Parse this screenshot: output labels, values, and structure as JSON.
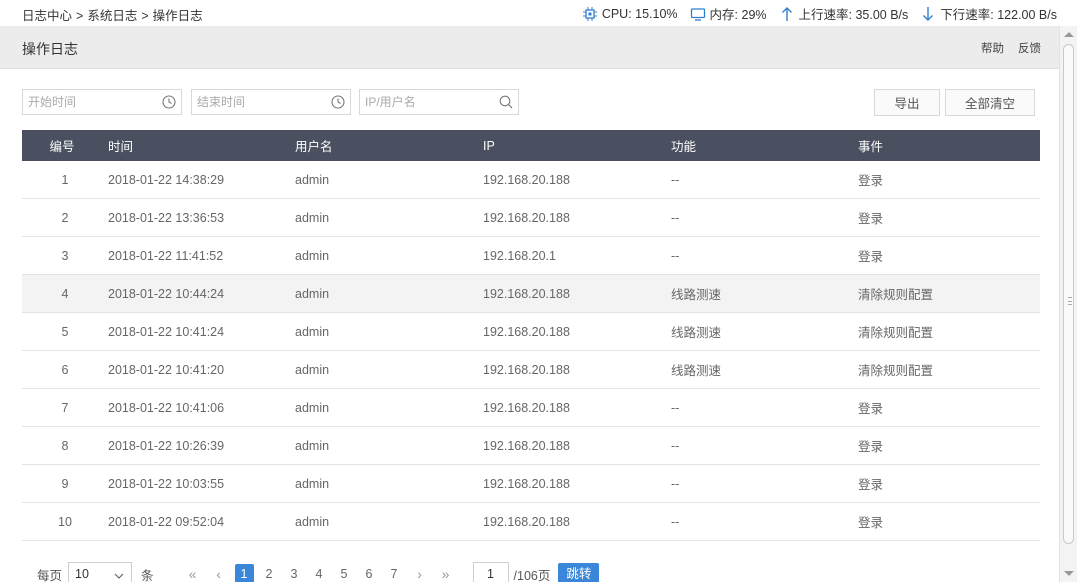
{
  "breadcrumb": [
    "日志中心",
    ">",
    "系统日志",
    ">",
    "操作日志"
  ],
  "stats": {
    "cpu_label": "CPU: 15.10%",
    "mem_label": "内存: 29%",
    "up_label": "上行速率: 35.00 B/s",
    "down_label": "下行速率: 122.00 B/s"
  },
  "header": {
    "title": "操作日志",
    "help": "帮助",
    "feedback": "反馈"
  },
  "filters": {
    "start_placeholder": "开始时间",
    "end_placeholder": "结束时间",
    "search_placeholder": "IP/用户名",
    "export_label": "导出",
    "clear_label": "全部清空"
  },
  "table": {
    "columns": [
      "编号",
      "时间",
      "用户名",
      "IP",
      "功能",
      "事件"
    ],
    "rows": [
      [
        "1",
        "2018-01-22 14:38:29",
        "admin",
        "192.168.20.188",
        "--",
        "登录"
      ],
      [
        "2",
        "2018-01-22 13:36:53",
        "admin",
        "192.168.20.188",
        "--",
        "登录"
      ],
      [
        "3",
        "2018-01-22 11:41:52",
        "admin",
        "192.168.20.1",
        "--",
        "登录"
      ],
      [
        "4",
        "2018-01-22 10:44:24",
        "admin",
        "192.168.20.188",
        "线路测速",
        "清除规则配置"
      ],
      [
        "5",
        "2018-01-22 10:41:24",
        "admin",
        "192.168.20.188",
        "线路测速",
        "清除规则配置"
      ],
      [
        "6",
        "2018-01-22 10:41:20",
        "admin",
        "192.168.20.188",
        "线路测速",
        "清除规则配置"
      ],
      [
        "7",
        "2018-01-22 10:41:06",
        "admin",
        "192.168.20.188",
        "--",
        "登录"
      ],
      [
        "8",
        "2018-01-22 10:26:39",
        "admin",
        "192.168.20.188",
        "--",
        "登录"
      ],
      [
        "9",
        "2018-01-22 10:03:55",
        "admin",
        "192.168.20.188",
        "--",
        "登录"
      ],
      [
        "10",
        "2018-01-22 09:52:04",
        "admin",
        "192.168.20.188",
        "--",
        "登录"
      ]
    ],
    "highlighted_row": 4
  },
  "pager": {
    "per_page_label": "每页",
    "per_page_value": "10",
    "per_page_unit": "条",
    "first": "«",
    "prev": "‹",
    "pages": [
      "1",
      "2",
      "3",
      "4",
      "5",
      "6",
      "7"
    ],
    "current": "1",
    "next": "›",
    "last": "»",
    "jump_value": "1",
    "total_label": "/106页",
    "go_label": "跳转"
  },
  "colors": {
    "header_bg": "#4a5060",
    "accent": "#3a86d8",
    "icon_blue": "#2f7fd0"
  }
}
